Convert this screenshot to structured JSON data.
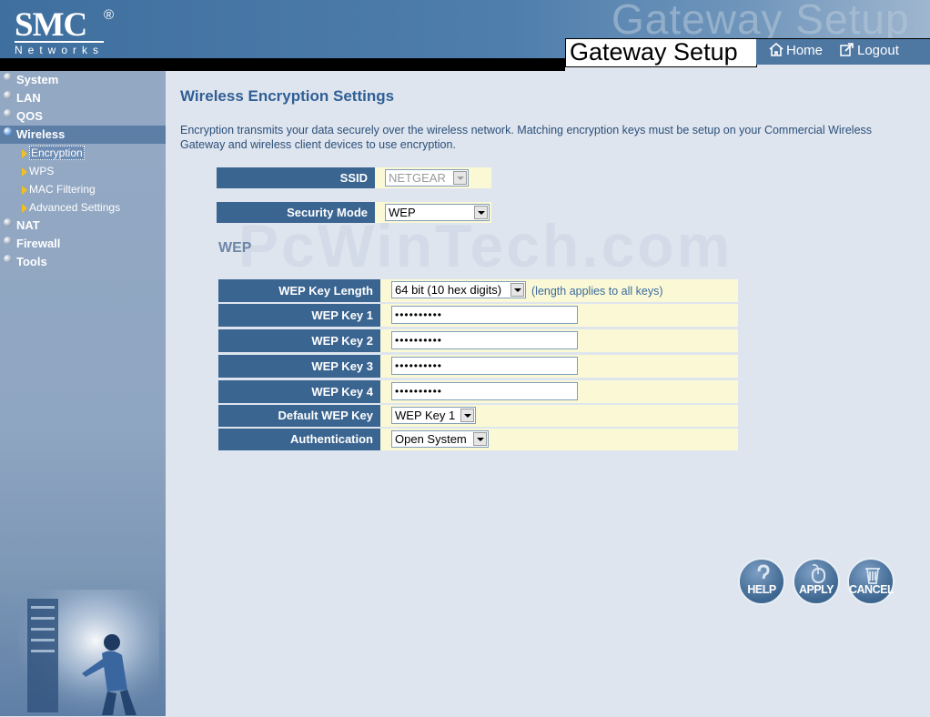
{
  "header": {
    "logo_brand": "SMC",
    "logo_registered": "®",
    "logo_sub": "Networks",
    "ghost_title": "Gateway Setup",
    "title": "Gateway Setup",
    "nav": {
      "home_label": "Home",
      "logout_label": "Logout"
    }
  },
  "sidebar": {
    "items": [
      {
        "label": "System"
      },
      {
        "label": "LAN"
      },
      {
        "label": "QOS"
      },
      {
        "label": "Wireless",
        "active": true
      },
      {
        "label": "NAT"
      },
      {
        "label": "Firewall"
      },
      {
        "label": "Tools"
      }
    ],
    "wireless_sub": [
      {
        "label": "Encryption",
        "current": true
      },
      {
        "label": "WPS"
      },
      {
        "label": "MAC Filtering"
      },
      {
        "label": "Advanced Settings"
      }
    ]
  },
  "main": {
    "title": "Wireless Encryption Settings",
    "description": "Encryption transmits your data securely over the wireless network. Matching encryption keys must be setup on your Commercial Wireless Gateway and wireless client devices to use encryption.",
    "watermark": "PcWinTech.com",
    "ssid": {
      "label": "SSID",
      "value": "NETGEAR"
    },
    "security_mode": {
      "label": "Security Mode",
      "value": "WEP"
    },
    "section_heading": "WEP",
    "wep": {
      "key_length": {
        "label": "WEP Key Length",
        "value": "64 bit (10 hex digits)",
        "note": "(length applies to all keys)"
      },
      "key1": {
        "label": "WEP Key 1",
        "value": "••••••••••"
      },
      "key2": {
        "label": "WEP Key 2",
        "value": "••••••••••"
      },
      "key3": {
        "label": "WEP Key 3",
        "value": "••••••••••"
      },
      "key4": {
        "label": "WEP Key 4",
        "value": "••••••••••"
      },
      "default_key": {
        "label": "Default WEP Key",
        "value": "WEP Key 1"
      },
      "authentication": {
        "label": "Authentication",
        "value": "Open System"
      }
    },
    "buttons": {
      "help": "HELP",
      "apply": "APPLY",
      "cancel": "CANCEL"
    }
  },
  "colors": {
    "header_blue": "#4f7eac",
    "label_cell": "#3b6591",
    "value_cell": "#fbf9d5",
    "title_text": "#2f5f95",
    "page_bg": "#dfe5ee"
  }
}
